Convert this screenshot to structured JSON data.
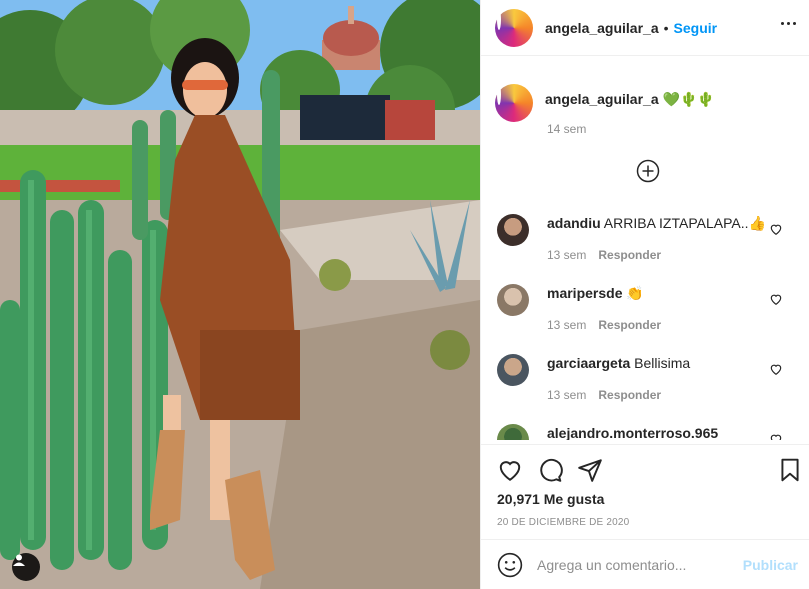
{
  "post": {
    "username": "angela_aguilar_a",
    "separator": "•",
    "follow_label": "Seguir",
    "more_icon": "more-horizontal-icon"
  },
  "caption": {
    "username": "angela_aguilar_a",
    "text": "💚🌵🌵",
    "time": "14 sem"
  },
  "load_more_icon": "plus-circle-icon",
  "comments": [
    {
      "username": "adandiu",
      "text": "ARRIBA IZTAPALAPA..👍",
      "time": "13 sem",
      "reply_label": "Responder"
    },
    {
      "username": "maripersde",
      "text": "👏",
      "time": "13 sem",
      "reply_label": "Responder"
    },
    {
      "username": "garciaargeta",
      "text": "Bellisima",
      "time": "13 sem",
      "reply_label": "Responder"
    },
    {
      "username": "alejandro.monterroso.965",
      "text": "",
      "time": "",
      "reply_label": ""
    }
  ],
  "actions": {
    "likes": "20,971 Me gusta",
    "date": "20 de diciembre de 2020"
  },
  "add_comment": {
    "placeholder": "Agrega un comentario...",
    "publish_label": "Publicar"
  },
  "colors": {
    "link_blue": "#0095f6",
    "publish_disabled": "#b2dffc",
    "muted_text": "#8e8e8e",
    "text": "#262626"
  }
}
